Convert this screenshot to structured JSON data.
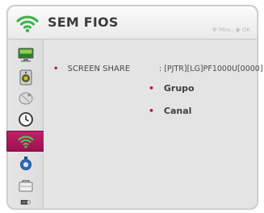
{
  "header": {
    "title": "SEM FIOS",
    "hint_move": "Mov.",
    "hint_ok": "OK",
    "icon": "wifi-icon"
  },
  "sidebar": {
    "items": [
      {
        "icon": "picture-icon"
      },
      {
        "icon": "sound-icon"
      },
      {
        "icon": "channel-dish-icon"
      },
      {
        "icon": "clock-icon"
      },
      {
        "icon": "wifi-icon",
        "active": true
      },
      {
        "icon": "option-icon"
      },
      {
        "icon": "lock-icon"
      },
      {
        "icon": "input-icon"
      }
    ]
  },
  "main": {
    "screen_share_label": "SCREEN SHARE",
    "screen_share_value": ": [PJTR][LG]PF1000U[0000]",
    "options": [
      "Grupo",
      "Canal"
    ]
  },
  "colors": {
    "accent": "#b0174f",
    "wifi_green": "#3bb54a"
  }
}
